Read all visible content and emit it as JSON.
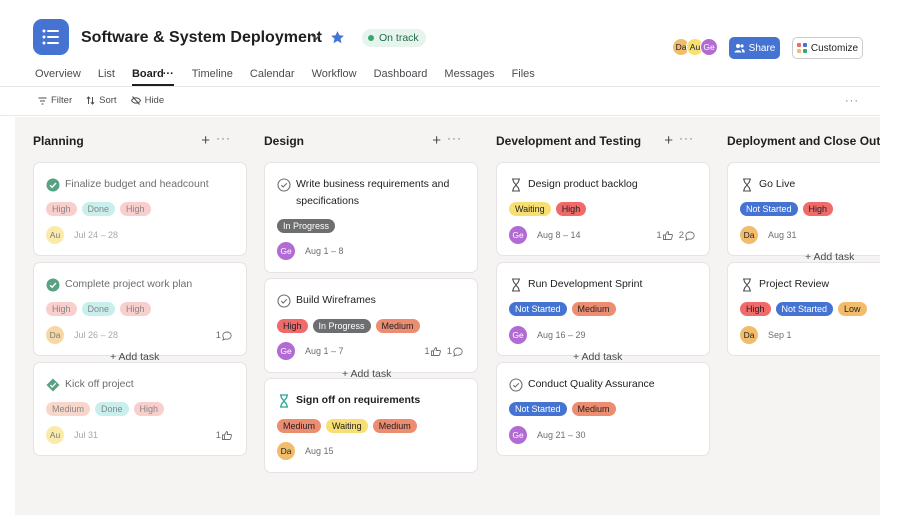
{
  "project": {
    "title": "Software & System Deployment",
    "status": "On track",
    "colors": {
      "accent": "#4573d2",
      "status_green": "#35a86d"
    }
  },
  "header": {
    "avatars": [
      {
        "initials": "Da",
        "color": "#f1bd6c"
      },
      {
        "initials": "Au",
        "color": "#f8df72"
      },
      {
        "initials": "Ge",
        "color": "#b36bd4"
      }
    ],
    "share_label": "Share",
    "customize_label": "Customize"
  },
  "tabs": [
    "Overview",
    "List",
    "Board",
    "Timeline",
    "Calendar",
    "Workflow",
    "Dashboard",
    "Messages",
    "Files"
  ],
  "active_tab": "Board",
  "toolbar": {
    "filter": "Filter",
    "sort": "Sort",
    "hide": "Hide"
  },
  "board": {
    "add_task_label": "+ Add task",
    "columns": [
      {
        "title": "Planning",
        "tasks": [
          {
            "title": "Finalize budget and headcount",
            "icon": "check-circle-icon",
            "done": true,
            "tags": [
              {
                "label": "High",
                "bg": "#f4a9a6"
              },
              {
                "label": "Done",
                "bg": "#9ee3e0"
              },
              {
                "label": "High",
                "bg": "#f4a9a6"
              }
            ],
            "assignee": "Au",
            "assignee_color": "#f8df72",
            "date": "Jul 24 – 28",
            "likes": "",
            "comments": ""
          },
          {
            "title": "Complete project work plan",
            "icon": "check-circle-icon",
            "done": true,
            "tags": [
              {
                "label": "High",
                "bg": "#f4a9a6"
              },
              {
                "label": "Done",
                "bg": "#9ee3e0"
              },
              {
                "label": "High",
                "bg": "#f4a9a6"
              }
            ],
            "assignee": "Da",
            "assignee_color": "#f1bd6c",
            "date": "Jul 26 – 28",
            "likes": "",
            "comments": "1"
          },
          {
            "title": "Kick off project",
            "icon": "milestone-done-icon",
            "done": true,
            "tags": [
              {
                "label": "Medium",
                "bg": "#f4b8a0"
              },
              {
                "label": "Done",
                "bg": "#9ee3e0"
              },
              {
                "label": "High",
                "bg": "#f4a9a6"
              }
            ],
            "assignee": "Au",
            "assignee_color": "#f8df72",
            "date": "Jul 31",
            "likes": "1",
            "comments": ""
          }
        ]
      },
      {
        "title": "Design",
        "tasks": [
          {
            "title": "Write business requirements and specifications",
            "icon": "check-circle-outline-icon",
            "done": false,
            "tags": [
              {
                "label": "In Progress",
                "bg": "#6d6e6f",
                "fg": "#ffffff"
              }
            ],
            "assignee": "Ge",
            "assignee_color": "#b36bd4",
            "date": "Aug 1 – 8",
            "likes": "",
            "comments": ""
          },
          {
            "title": "Build Wireframes",
            "icon": "check-circle-outline-icon",
            "done": false,
            "tags": [
              {
                "label": "High",
                "bg": "#f06a6a"
              },
              {
                "label": "In Progress",
                "bg": "#6d6e6f",
                "fg": "#ffffff"
              },
              {
                "label": "Medium",
                "bg": "#ec8d71"
              }
            ],
            "assignee": "Ge",
            "assignee_color": "#b36bd4",
            "date": "Aug 1 – 7",
            "likes": "1",
            "comments": "1"
          },
          {
            "title": "Sign off on requirements",
            "icon": "approval-hourglass-icon",
            "done": false,
            "bold": true,
            "tags": [
              {
                "label": "Medium",
                "bg": "#ec8d71"
              },
              {
                "label": "Waiting",
                "bg": "#f8df72"
              },
              {
                "label": "Medium",
                "bg": "#ec8d71"
              }
            ],
            "assignee": "Da",
            "assignee_color": "#f1bd6c",
            "date": "Aug 15",
            "likes": "",
            "comments": ""
          }
        ]
      },
      {
        "title": "Development and Testing",
        "tasks": [
          {
            "title": "Design product backlog",
            "icon": "hourglass-icon",
            "done": false,
            "tags": [
              {
                "label": "Waiting",
                "bg": "#f8df72"
              },
              {
                "label": "High",
                "bg": "#f06a6a"
              }
            ],
            "assignee": "Ge",
            "assignee_color": "#b36bd4",
            "date": "Aug 8 – 14",
            "likes": "1",
            "comments": "2"
          },
          {
            "title": "Run Development Sprint",
            "icon": "hourglass-icon",
            "done": false,
            "tags": [
              {
                "label": "Not Started",
                "bg": "#4573d2",
                "fg": "#ffffff"
              },
              {
                "label": "Medium",
                "bg": "#ec8d71"
              }
            ],
            "assignee": "Ge",
            "assignee_color": "#b36bd4",
            "date": "Aug 16 – 29",
            "likes": "",
            "comments": ""
          },
          {
            "title": "Conduct Quality Assurance",
            "icon": "check-circle-outline-icon",
            "done": false,
            "tags": [
              {
                "label": "Not Started",
                "bg": "#4573d2",
                "fg": "#ffffff"
              },
              {
                "label": "Medium",
                "bg": "#ec8d71"
              }
            ],
            "assignee": "Ge",
            "assignee_color": "#b36bd4",
            "date": "Aug 21 – 30",
            "likes": "",
            "comments": ""
          }
        ]
      },
      {
        "title": "Deployment and Close Out",
        "tasks": [
          {
            "title": "Go Live",
            "icon": "hourglass-icon",
            "done": false,
            "tags": [
              {
                "label": "Not Started",
                "bg": "#4573d2",
                "fg": "#ffffff"
              },
              {
                "label": "High",
                "bg": "#f06a6a"
              }
            ],
            "assignee": "Da",
            "assignee_color": "#f1bd6c",
            "date": "Aug 31",
            "likes": "",
            "comments": ""
          },
          {
            "title": "Project Review",
            "icon": "hourglass-icon",
            "done": false,
            "tags": [
              {
                "label": "High",
                "bg": "#f06a6a"
              },
              {
                "label": "Not Started",
                "bg": "#4573d2",
                "fg": "#ffffff"
              },
              {
                "label": "Low",
                "bg": "#f1bd6c"
              }
            ],
            "assignee": "Da",
            "assignee_color": "#f1bd6c",
            "date": "Sep 1",
            "likes": "",
            "comments": ""
          }
        ]
      }
    ]
  }
}
